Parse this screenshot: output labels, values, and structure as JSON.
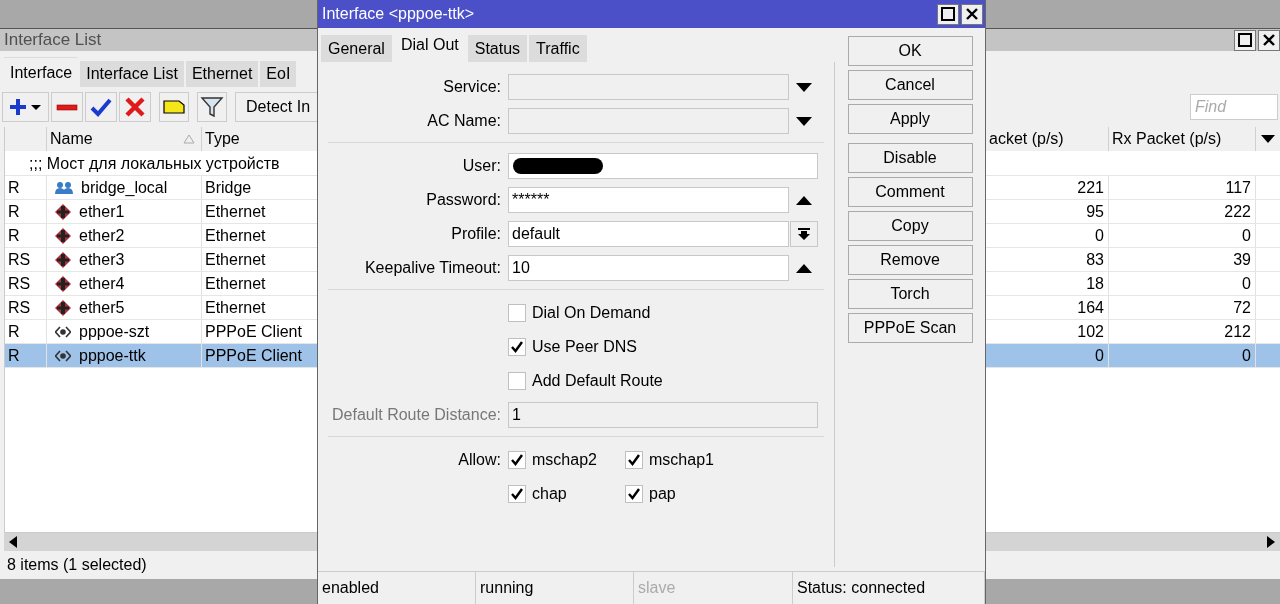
{
  "list_window": {
    "title": "Interface List",
    "tabs": [
      {
        "label": "Interface",
        "selected": true
      },
      {
        "label": "Interface List",
        "selected": false
      },
      {
        "label": "Ethernet",
        "selected": false
      },
      {
        "label": "EoI",
        "selected": false
      }
    ],
    "detect_button": "Detect In",
    "find": {
      "placeholder": "Find"
    },
    "columns": [
      "Name",
      "Type",
      "acket (p/s)",
      "Rx Packet (p/s)"
    ],
    "rows": [
      {
        "kind": "comment",
        "text": ";;; Мост для локальных устройств"
      },
      {
        "kind": "bridge",
        "flags": "R",
        "name": "bridge_local",
        "type": "Bridge",
        "tx": "221",
        "rx": "117",
        "selected": false
      },
      {
        "kind": "ethernet",
        "flags": "R",
        "name": "ether1",
        "type": "Ethernet",
        "tx": "95",
        "rx": "222",
        "selected": false
      },
      {
        "kind": "ethernet",
        "flags": "R",
        "name": "ether2",
        "type": "Ethernet",
        "tx": "0",
        "rx": "0",
        "selected": false
      },
      {
        "kind": "ethernet",
        "flags": "RS",
        "name": "ether3",
        "type": "Ethernet",
        "tx": "83",
        "rx": "39",
        "selected": false
      },
      {
        "kind": "ethernet",
        "flags": "RS",
        "name": "ether4",
        "type": "Ethernet",
        "tx": "18",
        "rx": "0",
        "selected": false
      },
      {
        "kind": "ethernet",
        "flags": "RS",
        "name": "ether5",
        "type": "Ethernet",
        "tx": "164",
        "rx": "72",
        "selected": false
      },
      {
        "kind": "pppoe",
        "flags": "R",
        "name": "pppoe-szt",
        "type": "PPPoE Client",
        "tx": "102",
        "rx": "212",
        "selected": false
      },
      {
        "kind": "pppoe",
        "flags": "R",
        "name": "pppoe-ttk",
        "type": "PPPoE Client",
        "tx": "0",
        "rx": "0",
        "selected": true
      }
    ],
    "status": "8 items (1 selected)"
  },
  "dialog": {
    "title": "Interface <pppoe-ttk>",
    "tabs": [
      {
        "label": "General",
        "selected": false
      },
      {
        "label": "Dial Out",
        "selected": true
      },
      {
        "label": "Status",
        "selected": false
      },
      {
        "label": "Traffic",
        "selected": false
      }
    ],
    "sections": [
      {
        "kind": "fields",
        "fields": [
          {
            "label": "Service:",
            "kind": "dropdown"
          },
          {
            "label": "AC Name:",
            "kind": "dropdown"
          }
        ]
      },
      {
        "kind": "fields",
        "fields": [
          {
            "label": "User:",
            "kind": "redacted"
          },
          {
            "label": "Password:",
            "kind": "toggle",
            "value": "******"
          },
          {
            "label": "Profile:",
            "kind": "menu",
            "value": "default"
          },
          {
            "label": "Keepalive Timeout:",
            "kind": "toggle",
            "value": "10"
          }
        ]
      },
      {
        "kind": "checks",
        "checks": [
          {
            "label": "Dial On Demand",
            "checked": false
          },
          {
            "label": "Use Peer DNS",
            "checked": true
          },
          {
            "label": "Add Default Route",
            "checked": false
          }
        ],
        "fields": [
          {
            "label": "Default Route Distance:",
            "kind": "plain",
            "value": "1",
            "disabled": true
          }
        ]
      },
      {
        "kind": "allow",
        "label": "Allow:",
        "checks": [
          {
            "label": "mschap2",
            "checked": true
          },
          {
            "label": "mschap1",
            "checked": true
          },
          {
            "label": "chap",
            "checked": true
          },
          {
            "label": "pap",
            "checked": true
          }
        ]
      }
    ],
    "button_groups": [
      [
        "OK",
        "Cancel",
        "Apply"
      ],
      [
        "Disable",
        "Comment",
        "Copy",
        "Remove",
        "Torch",
        "PPPoE Scan"
      ]
    ],
    "status_bar": [
      {
        "text": "enabled",
        "disabled": false
      },
      {
        "text": "running",
        "disabled": false
      },
      {
        "text": "slave",
        "disabled": true
      },
      {
        "text": "Status: connected",
        "disabled": false
      }
    ]
  }
}
